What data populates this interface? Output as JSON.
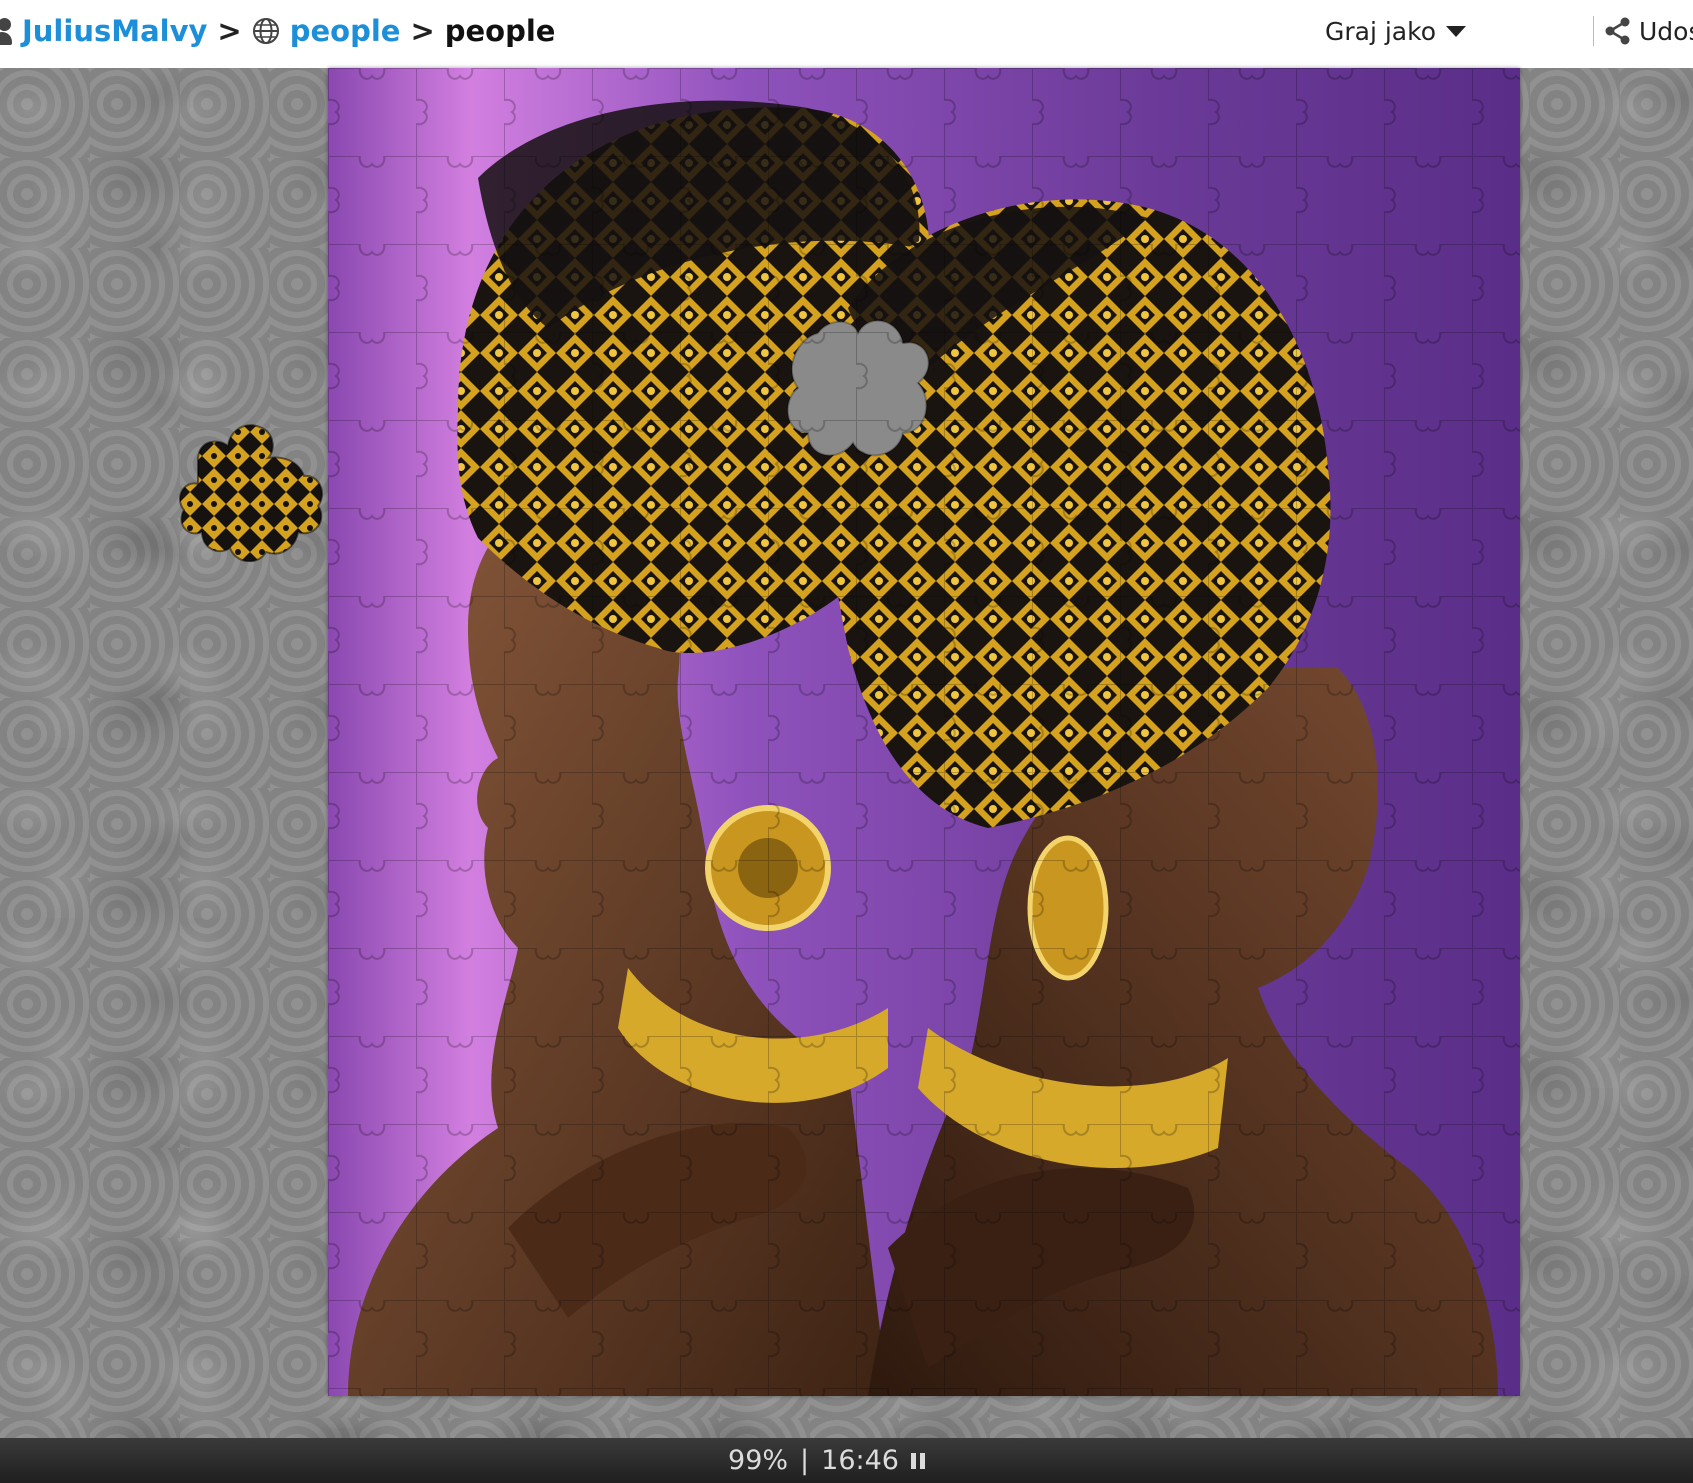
{
  "breadcrumb": {
    "user": "JuliusMalvy",
    "separator": ">",
    "category": "people",
    "current": "people"
  },
  "actions": {
    "play_as": "Graj jako",
    "share": "Udostępnij"
  },
  "status": {
    "progress": "99%",
    "divider": "|",
    "time": "16:46",
    "progress_value": 0.99
  },
  "icons": {
    "user": "user-icon",
    "globe": "globe-icon",
    "play_as_dropdown": "chevron-down-icon",
    "share": "share-icon",
    "share_dropdown": "chevron-down-icon",
    "pause": "pause-icon"
  },
  "colors": {
    "link": "#1c8fd8",
    "board": "#8a8a8a",
    "statusbar": "#2a2a2a",
    "puzzle_background": "#7b3fa8",
    "headwrap_gold": "#d9a520"
  }
}
